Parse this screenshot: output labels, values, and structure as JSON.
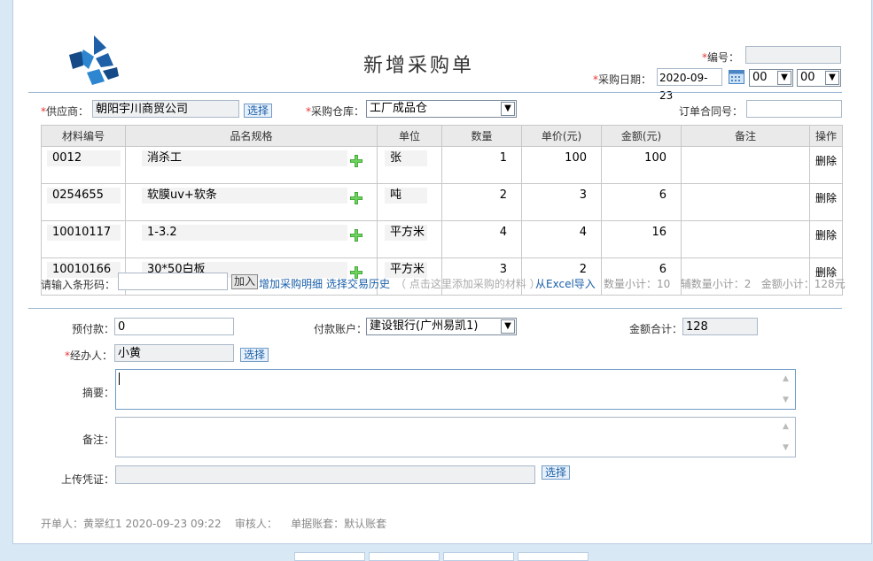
{
  "title": "新增采购单",
  "header": {
    "number_label": "编号：",
    "number_value": "",
    "date_label": "采购日期：",
    "date_value": "2020-09-23",
    "hour_value": "00",
    "minute_value": "00"
  },
  "supplier": {
    "label": "供应商：",
    "value": "朝阳宇川商贸公司",
    "choose": "选择"
  },
  "warehouse": {
    "label": "采购仓库：",
    "value": "工厂成品仓"
  },
  "contract": {
    "label": "订单合同号：",
    "value": ""
  },
  "table": {
    "headers": [
      "材料编号",
      "品名规格",
      "单位",
      "数量",
      "单价(元)",
      "金额(元)",
      "备注",
      "操作"
    ],
    "rows": [
      {
        "code": "0012",
        "name": "消杀工",
        "unit": "张",
        "qty": "1",
        "price": "100",
        "amount": "100",
        "remark": "",
        "action": "删除"
      },
      {
        "code": "0254655",
        "name": "软膜uv+软条",
        "unit": "吨",
        "qty": "2",
        "price": "3",
        "amount": "6",
        "remark": "",
        "action": "删除"
      },
      {
        "code": "10010117",
        "name": "1-3.2",
        "unit": "平方米",
        "qty": "4",
        "price": "4",
        "amount": "16",
        "remark": "",
        "action": "删除"
      },
      {
        "code": "10010166",
        "name": "30*50白板",
        "unit": "平方米",
        "qty": "3",
        "price": "2",
        "amount": "6",
        "remark": "",
        "action": "删除"
      }
    ]
  },
  "barcode": {
    "label": "请输入条形码：",
    "add": "加入",
    "add_detail": "增加采购明细",
    "history": "选择交易历史",
    "hint": "（ 点击这里添加采购的材料 ）",
    "excel": "从Excel导入",
    "summary": "数量小计：10   辅数量小计：2   金额小计：128元"
  },
  "payment": {
    "prepay_label": "预付款：",
    "prepay_value": "0",
    "account_label": "付款账户：",
    "account_value": "建设银行(广州易凯1)",
    "total_label": "金额合计：",
    "total_value": "128"
  },
  "handler": {
    "label": "经办人：",
    "value": "小黄",
    "choose": "选择"
  },
  "summary_label": "摘要：",
  "remark_label": "备注：",
  "upload": {
    "label": "上传凭证：",
    "choose": "选择"
  },
  "footer": "开单人：黄翠红1 2020-09-23 09:22    审核人：    单据账套：默认账套",
  "colors": {
    "accent": "#1a5fa8",
    "required": "#e33333",
    "divider": "#9ab7d5"
  }
}
